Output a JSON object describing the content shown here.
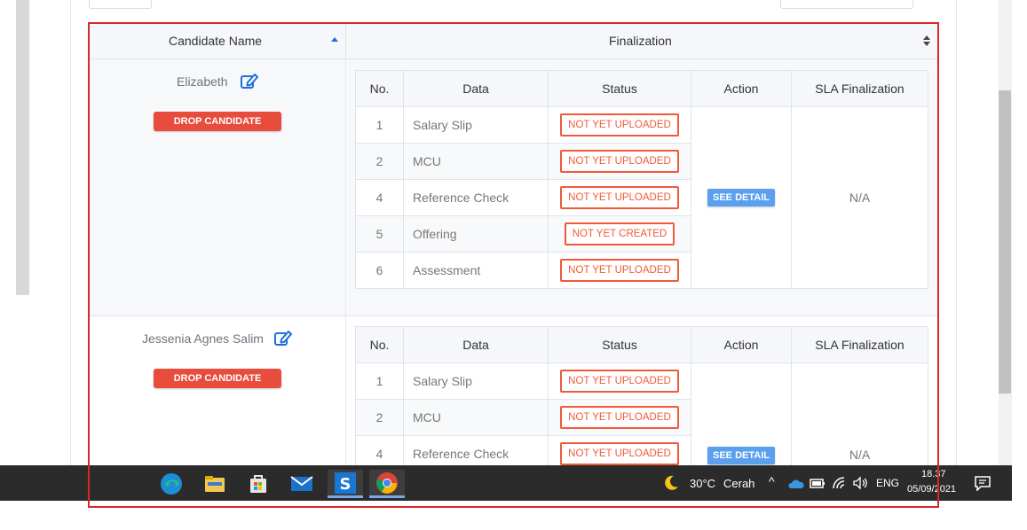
{
  "table": {
    "header": {
      "candidate_name": "Candidate Name",
      "finalization": "Finalization"
    },
    "inner_headers": {
      "no": "No.",
      "data": "Data",
      "status": "Status",
      "action": "Action",
      "sla": "SLA Finalization"
    },
    "candidates": [
      {
        "name": "Elizabeth",
        "drop_label": "DROP CANDIDATE",
        "action_label": "SEE DETAIL",
        "sla": "N/A",
        "rows": [
          {
            "no": "1",
            "data": "Salary Slip",
            "status": "NOT YET UPLOADED"
          },
          {
            "no": "2",
            "data": "MCU",
            "status": "NOT YET UPLOADED"
          },
          {
            "no": "4",
            "data": "Reference Check",
            "status": "NOT YET UPLOADED"
          },
          {
            "no": "5",
            "data": "Offering",
            "status": "NOT YET CREATED"
          },
          {
            "no": "6",
            "data": "Assessment",
            "status": "NOT YET UPLOADED"
          }
        ]
      },
      {
        "name": "Jessenia Agnes Salim",
        "drop_label": "DROP CANDIDATE",
        "action_label": "SEE DETAIL",
        "sla": "N/A",
        "rows": [
          {
            "no": "1",
            "data": "Salary Slip",
            "status": "NOT YET UPLOADED"
          },
          {
            "no": "2",
            "data": "MCU",
            "status": "NOT YET UPLOADED"
          },
          {
            "no": "4",
            "data": "Reference Check",
            "status": "NOT YET UPLOADED"
          }
        ]
      }
    ]
  },
  "taskbar": {
    "apps": [
      "edge-icon",
      "file-explorer-icon",
      "store-icon",
      "mail-icon",
      "app-s-icon",
      "chrome-icon"
    ],
    "weather": {
      "temp": "30°C",
      "condition": "Cerah",
      "icon": "moon-icon"
    },
    "language": "ENG",
    "time": "18.37",
    "date": "05/09/2021"
  },
  "colors": {
    "drop_button": "#e74c3c",
    "status_border": "#f05a3a",
    "see_detail": "#5aa0ee",
    "highlight": "#d9262b",
    "taskbar": "#2b2b2b"
  }
}
